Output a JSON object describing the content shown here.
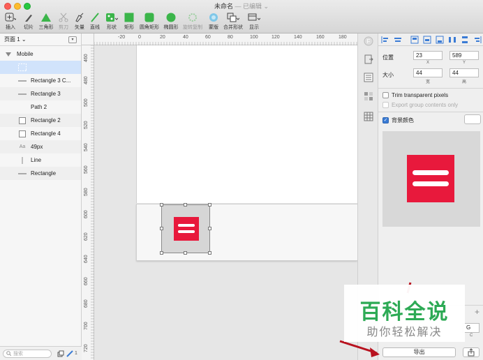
{
  "window": {
    "title": "未命名",
    "subtitle": "— 已编辑 ⌄"
  },
  "toolbar": {
    "tools": [
      {
        "label": "插入",
        "icon": "plus-icon",
        "dim": false
      },
      {
        "label": "切片",
        "icon": "knife-icon",
        "dim": false
      },
      {
        "label": "三角形",
        "icon": "triangle-icon",
        "dim": false
      },
      {
        "label": "剪刀",
        "icon": "scissors-icon",
        "dim": true
      },
      {
        "label": "矢量",
        "icon": "pen-icon",
        "dim": false
      },
      {
        "label": "直线",
        "icon": "line-icon",
        "dim": false
      },
      {
        "label": "形状",
        "icon": "shape-icon",
        "dim": false
      },
      {
        "label": "矩形",
        "icon": "rectangle-icon",
        "dim": false
      },
      {
        "label": "圆角矩形",
        "icon": "rounded-rect-icon",
        "dim": false
      },
      {
        "label": "椭圆形",
        "icon": "oval-icon",
        "dim": false
      },
      {
        "label": "旋转复制",
        "icon": "rotate-copy-icon",
        "dim": true
      },
      {
        "label": "蒙版",
        "icon": "mask-icon",
        "dim": false
      },
      {
        "label": "合并形状",
        "icon": "union-icon",
        "dim": false
      },
      {
        "label": "显示",
        "icon": "view-icon",
        "dim": false
      }
    ]
  },
  "layers": {
    "page_label": "页面 1 ⌄",
    "group_name": "Mobile",
    "items": [
      {
        "name": "",
        "type": "selected-slice"
      },
      {
        "name": "Rectangle 3 C...",
        "type": "line"
      },
      {
        "name": "Rectangle 3",
        "type": "line"
      },
      {
        "name": "Path 2",
        "type": "none"
      },
      {
        "name": "Rectangle 2",
        "type": "square"
      },
      {
        "name": "Rectangle 4",
        "type": "square"
      },
      {
        "name": "49px",
        "type": "text"
      },
      {
        "name": "Line",
        "type": "vline"
      },
      {
        "name": "Rectangle",
        "type": "line"
      }
    ],
    "search_placeholder": "搜索",
    "text_icon_glyph": "Aa",
    "layer_count": "1"
  },
  "ruler": {
    "h_ticks": [
      "-20",
      "0",
      "20",
      "40",
      "60",
      "80",
      "100",
      "120",
      "140",
      "160",
      "180"
    ],
    "v_ticks": [
      "460",
      "480",
      "500",
      "520",
      "540",
      "560",
      "580",
      "600",
      "620",
      "640",
      "660",
      "680",
      "700",
      "720"
    ]
  },
  "inspector": {
    "position_label": "位置",
    "x_value": "23",
    "y_value": "589",
    "x_cap": "X",
    "y_cap": "Y",
    "size_label": "大小",
    "width_value": "44",
    "height_value": "44",
    "width_cap": "宽",
    "height_cap": "高",
    "trim_label": "Trim transparent pixels",
    "export_group_label": "Export group contents only",
    "bg_color_label": "背景颜色",
    "export_button": "导出",
    "side_field_value": "G",
    "side_field_cap": "C"
  },
  "colors": {
    "accent_red": "#e8193c",
    "checkbox_blue": "#3a7bd5"
  },
  "watermark": {
    "title": "百科全说",
    "subtitle": "助你轻松解决"
  }
}
